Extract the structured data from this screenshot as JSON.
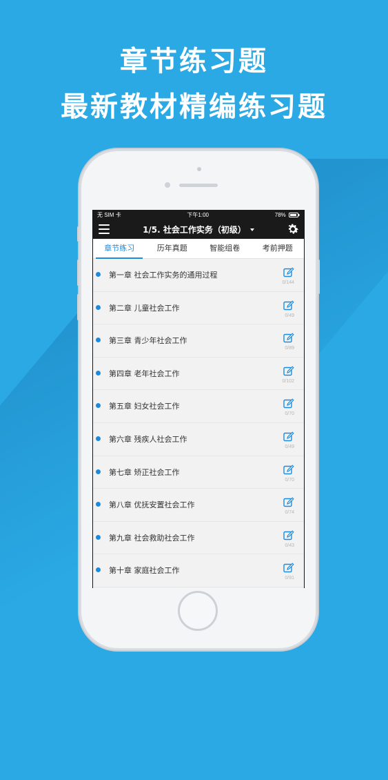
{
  "headline": {
    "line1": "章节练习题",
    "line2": "最新教材精编练习题"
  },
  "status_bar": {
    "carrier": "无 SIM 卡",
    "time": "下午1:00",
    "battery": "78%"
  },
  "navbar": {
    "title": "1/5. 社会工作实务（初级）"
  },
  "tabs": [
    {
      "label": "章节练习",
      "active": true
    },
    {
      "label": "历年真题",
      "active": false
    },
    {
      "label": "智能组卷",
      "active": false
    },
    {
      "label": "考前押题",
      "active": false
    }
  ],
  "chapters": [
    {
      "title": "第一章 社会工作实务的通用过程",
      "count": "0/144"
    },
    {
      "title": "第二章 儿童社会工作",
      "count": "0/49"
    },
    {
      "title": "第三章 青少年社会工作",
      "count": "0/89"
    },
    {
      "title": "第四章 老年社会工作",
      "count": "0/102"
    },
    {
      "title": "第五章 妇女社会工作",
      "count": "0/70"
    },
    {
      "title": "第六章 残疾人社会工作",
      "count": "0/49"
    },
    {
      "title": "第七章 矫正社会工作",
      "count": "0/70"
    },
    {
      "title": "第八章 优抚安置社会工作",
      "count": "0/74"
    },
    {
      "title": "第九章 社会救助社会工作",
      "count": "0/43"
    },
    {
      "title": "第十章 家庭社会工作",
      "count": "0/91"
    }
  ],
  "colors": {
    "background": "#2aa9e4",
    "accent": "#1b8be0",
    "bar": "#1a1a1a"
  }
}
